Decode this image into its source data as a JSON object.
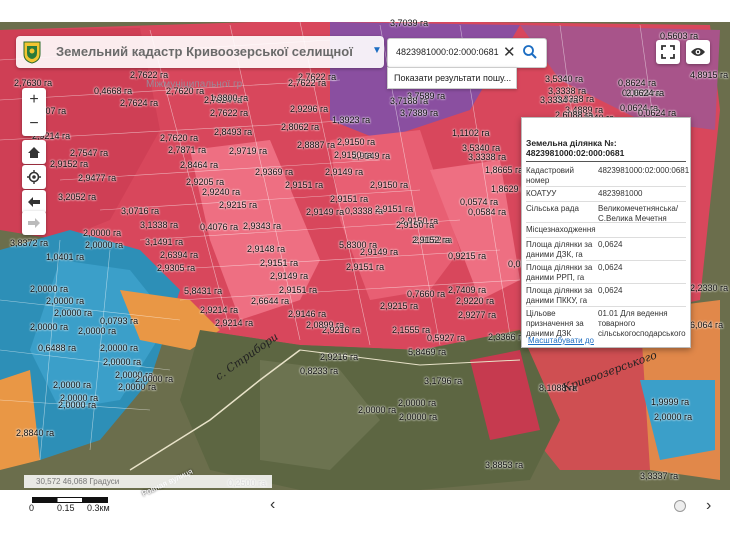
{
  "app": {
    "title": "Земельний кадастр Кривоозерської селищної",
    "watermark": "Міжмуніципальної гр",
    "logo": "coat-of-arms-icon"
  },
  "search": {
    "value": "4823981000:02:000:0681",
    "result_link": "Показати результати пошу..."
  },
  "controls": {
    "zoom_in": "+",
    "zoom_out": "−",
    "home": "home-icon",
    "locate": "locate-icon",
    "back": "arrow-left-icon",
    "forward": "arrow-right-icon",
    "fullscreen": "fullscreen-icon",
    "visibility": "eye-icon"
  },
  "popup": {
    "title": "Земельна ділянка №: 4823981000:02:000:0681",
    "rows": [
      {
        "key": "Кадастровий номер",
        "value": "4823981000:02:000:0681"
      },
      {
        "key": "КОАТУУ",
        "value": "4823981000"
      },
      {
        "key": "Сільська рада",
        "value": "Великомечетнянська/ С.Велика Мечетня"
      },
      {
        "key": "Місцезнаходження",
        "value": ""
      },
      {
        "key": "Площа ділянки за даними ДЗК, га",
        "value": "0,0624"
      },
      {
        "key": "Площа ділянки за даними РРП, га",
        "value": "0,0624"
      },
      {
        "key": "Площа ділянки за даними ПККУ, га",
        "value": "0,0624"
      },
      {
        "key": "Цільове призначення за даними ДЗК",
        "value": "01.01 Для ведення товарного сільськогосподарського"
      }
    ],
    "zoom_link": "Масштабувати до"
  },
  "status": {
    "coords": "30,572 46,068 Градуси",
    "scale_labels": [
      "0",
      "0.15",
      "0.3км"
    ]
  },
  "map_labels": [
    "2,7630 га",
    "0,4668 га",
    "2,8807 га",
    "2,7624 га",
    "2,9214 га",
    "2,7547 га",
    "2,9152 га",
    "2,9477 га",
    "3,2052 га",
    "3,0716 га",
    "3,1338 га",
    "2,7622 га",
    "2,7620 га",
    "2,7624 га",
    "2,7622 га",
    "2,7620 га",
    "1,3800 га",
    "2,8493 га",
    "2,8464 га",
    "2,7871 га",
    "2,9719 га",
    "2,9205 га",
    "2,9240 га",
    "2,9215 га",
    "0,4076 га",
    "2,9343 га",
    "2,9369 га",
    "2,7622 га",
    "2,8062 га",
    "2,9296 га",
    "1,3923 га",
    "2,8887 га",
    "2,9150 га",
    "2,9149 га",
    "2,9151 га",
    "2,9150 га",
    "2,9149 га",
    "0,3338 га",
    "2,9151 га",
    "2,9151 га",
    "2,9149 га",
    "2,9150 га",
    "2,9152 га",
    "5,8300 га",
    "2,9151 га",
    "2,9149 га",
    "2,9150 га",
    "2,9148 га",
    "2,9151 га",
    "2,9149 га",
    "2,9151 га",
    "2,6644 га",
    "5,8431 га",
    "2,9214 га",
    "2,9214 га",
    "2,9146 га",
    "2,0899 га",
    "2,9216 га",
    "2,9216 га",
    "2,9215 га",
    "2,1555 га",
    "1,0401 га",
    "2,0000 га",
    "3,1491 га",
    "2,6394 га",
    "2,9305 га",
    "2,0000 га",
    "2,0000 га",
    "2,0000 га",
    "0,0793 га",
    "2,0000 га",
    "2,0000 га",
    "2,0000 га",
    "0,6488 га",
    "2,0000 га",
    "2,0000 га",
    "2,0000 га",
    "2,0000 га",
    "2,0000 га",
    "2,0000 га",
    "2,0000 га",
    "2,0000 га",
    "2,8840 га",
    "0,2500 га",
    "0,8233 га",
    "5,8469 га",
    "3,1796 га",
    "2,0000 га",
    "2,0000 га",
    "2,0000 га",
    "3,5340 га",
    "3,3338 га",
    "3,3338 га",
    "3,4889 га",
    "3,3340 га",
    "0,8624 га",
    "0,0624 га",
    "0,0624 га",
    "0,0624 га",
    "0,0624 га",
    "1,1102 га",
    "3,5340 га",
    "3,3338 га",
    "1,8665 га",
    "1,8629 га",
    "0,0574 га",
    "0,0584 га",
    "0,0544 га",
    "0,7660 га",
    "2,7409 га",
    "2,9220 га",
    "2,9277 га",
    "0,5927 га",
    "2,3366 га",
    "0,9215 га",
    "8,1088 га",
    "1,9999 га",
    "2,0000 га",
    "3,3337 га",
    "3,7039 га",
    "3,7188 га",
    "3,7389 га",
    "2,9150 га",
    "2,9152 га",
    "0,5603 га",
    "3,8372 га",
    "2,7622 га",
    "3,7589 га",
    "4,8915 га",
    "2,2330 га",
    "6,064 га",
    "3,3334 га",
    "2,6088 га",
    "3,8853 га",
    "2,0624 га"
  ],
  "road_label": "Ровная вулиця",
  "handwriting": [
    "с. Стрибори",
    "Кривоозерського"
  ],
  "colors": {
    "parcel_red": "#d8475c",
    "parcel_pink": "#ee6f82",
    "parcel_blue": "#2d8fb7",
    "parcel_orange": "#e99745",
    "parcel_purple": "#8a4fa0",
    "imagery_green": "#5d6642",
    "link_blue": "#1c6dc2"
  }
}
